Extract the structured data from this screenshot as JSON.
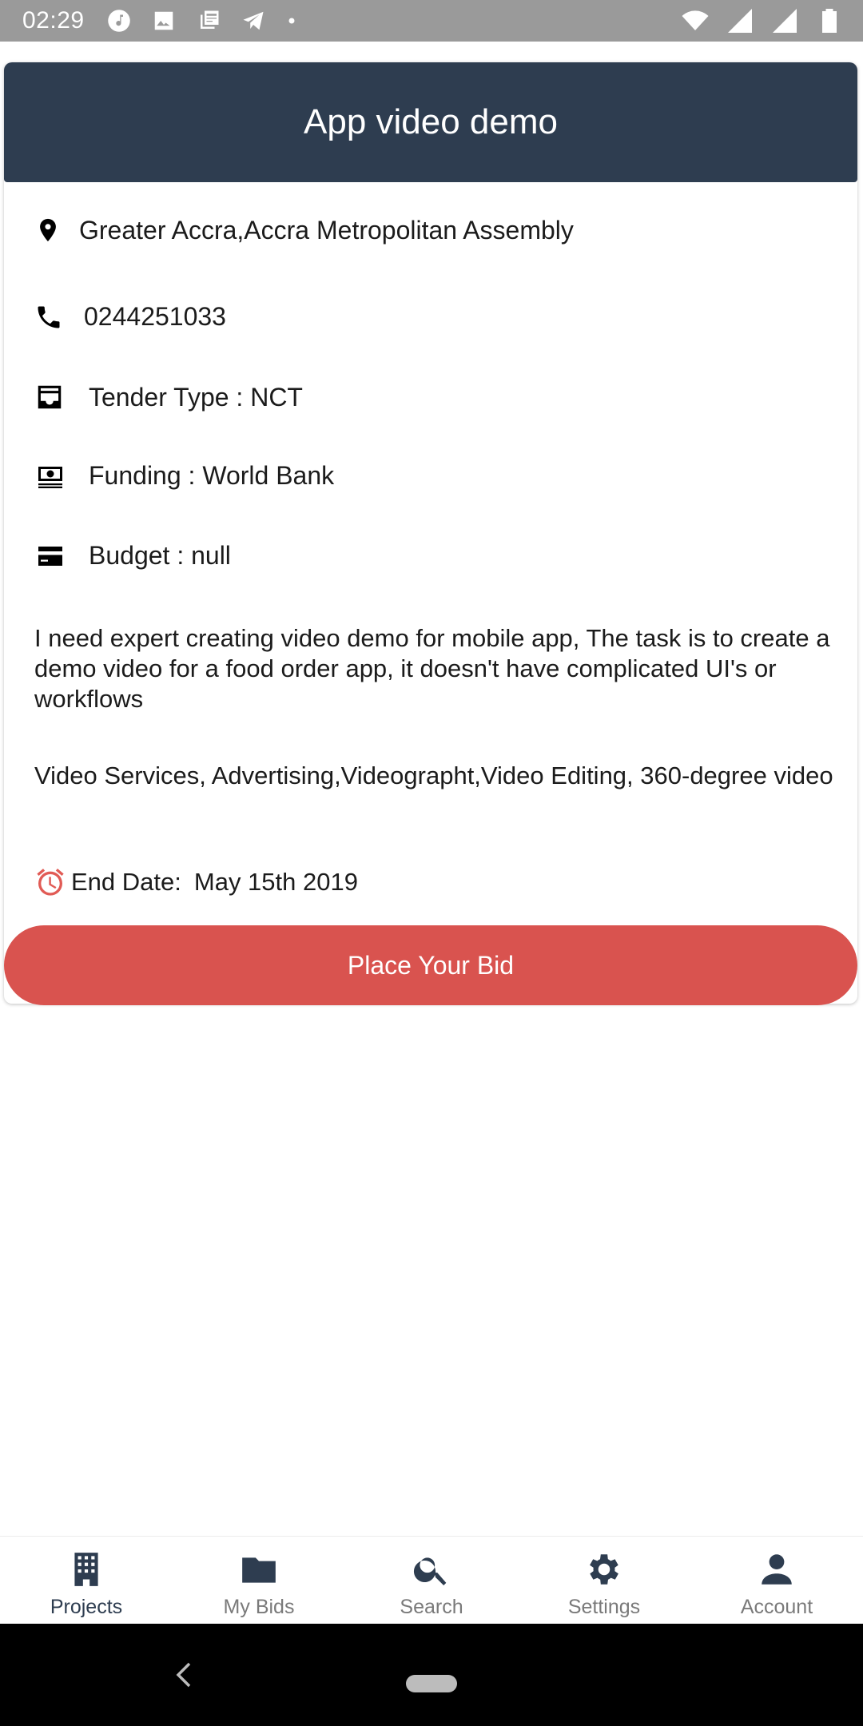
{
  "status_bar": {
    "time": "02:29"
  },
  "header": {
    "title": "App video demo"
  },
  "details": {
    "location": "Greater Accra,Accra Metropolitan Assembly",
    "phone": "0244251033",
    "tender_type": "Tender Type : NCT",
    "funding": "Funding : World Bank",
    "budget": "Budget : null",
    "description": "I need expert creating video demo for mobile app, The task is to create a demo video for a food order app, it doesn't have complicated UI's or workflows",
    "categories": "Video Services, Advertising,Videographt,Video Editing, 360-degree video",
    "end_date_label": "End Date:",
    "end_date_value": "May 15th 2019"
  },
  "actions": {
    "bid_label": "Place Your Bid"
  },
  "bottom_nav": {
    "items": [
      {
        "label": "Projects",
        "icon": "building-icon",
        "active": true
      },
      {
        "label": "My Bids",
        "icon": "folder-icon",
        "active": false
      },
      {
        "label": "Search",
        "icon": "search-icon",
        "active": false
      },
      {
        "label": "Settings",
        "icon": "gear-icon",
        "active": false
      },
      {
        "label": "Account",
        "icon": "person-icon",
        "active": false
      }
    ]
  },
  "colors": {
    "header_bg": "#2e3d50",
    "accent_red": "#d9534f",
    "alarm_icon": "#e15b55",
    "nav_icon": "#2e3d50"
  }
}
